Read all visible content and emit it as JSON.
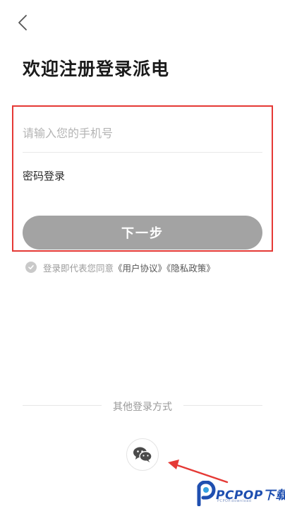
{
  "header": {
    "back_icon": "chevron-left-icon",
    "title": "欢迎注册登录派电"
  },
  "form": {
    "phone_placeholder": "请输入您的手机号",
    "phone_value": "",
    "password_login_label": "密码登录",
    "next_button_label": "下一步",
    "next_button_color": "#a3a3a3",
    "highlight_color": "#e53935"
  },
  "agreement": {
    "prefix": "登录即代表您同意",
    "user_agreement": "《用户协议》",
    "privacy_policy": "《隐私政策》"
  },
  "other_login": {
    "label": "其他登录方式",
    "wechat_icon": "wechat-icon"
  },
  "watermark": {
    "brand": "PCPOP下载",
    "sub": "PCPOP.download"
  }
}
